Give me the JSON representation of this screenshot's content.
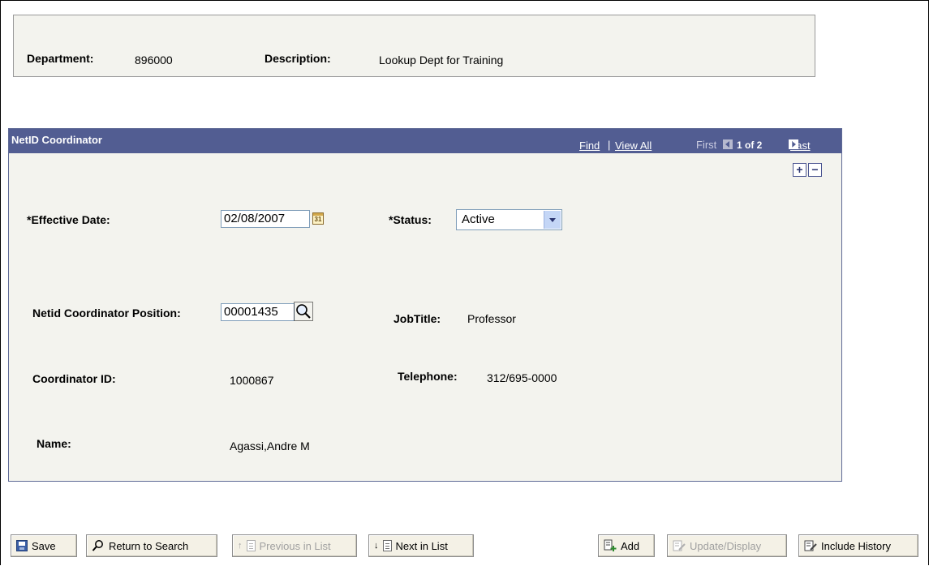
{
  "header": {
    "department_label": "Department:",
    "department_value": "896000",
    "description_label": "Description:",
    "description_value": "Lookup Dept for Training"
  },
  "grid": {
    "title": "NetID Coordinator",
    "find_link": "Find",
    "separator": "|",
    "view_all_link": "View All",
    "first_label": "First",
    "page_indicator": "1 of 2",
    "last_link": "Last",
    "add_row": "+",
    "delete_row": "−"
  },
  "form": {
    "effective_date_label": "*Effective Date:",
    "effective_date_value": "02/08/2007",
    "calendar_icon_text": "31",
    "status_label": "*Status:",
    "status_value": "Active",
    "position_label": "Netid Coordinator Position:",
    "position_value": "00001435",
    "jobtitle_label": "JobTitle:",
    "jobtitle_value": "Professor",
    "coordinator_id_label": "Coordinator ID:",
    "coordinator_id_value": "1000867",
    "telephone_label": "Telephone:",
    "telephone_value": "312/695-0000",
    "name_label": "Name:",
    "name_value": "Agassi,Andre M"
  },
  "toolbar": {
    "save": "Save",
    "return_to_search": "Return to Search",
    "previous_in_list": "Previous in List",
    "next_in_list": "Next in List",
    "add": "Add",
    "update_display": "Update/Display",
    "include_history": "Include History"
  },
  "colors": {
    "panel_header": "#525d92",
    "panel_background": "#f3f3ee",
    "button_face": "#f4f1e6"
  }
}
